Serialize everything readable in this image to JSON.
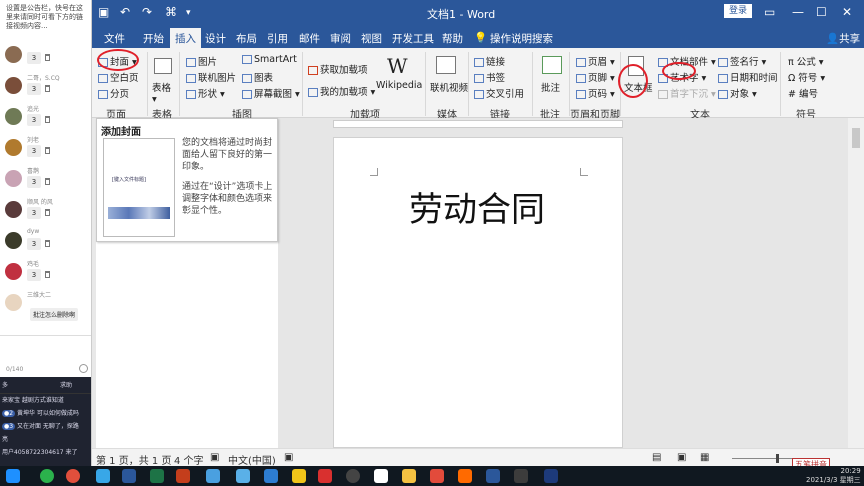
{
  "chat": {
    "note": "设置是公告栏，快号在这里来请同时可看下方的链接视频内容...",
    "messages": [
      {
        "name": "",
        "count": "3",
        "color": "#8a6b52"
      },
      {
        "name": "二哥，S.CQ",
        "count": "3",
        "color": "#7a4e3a"
      },
      {
        "name": "追光",
        "count": "3",
        "color": "#6f7a56"
      },
      {
        "name": "刘老",
        "count": "3",
        "color": "#b07a2e"
      },
      {
        "name": "喜鹊",
        "count": "3",
        "color": "#c9a3b4"
      },
      {
        "name": "顺风 的风",
        "count": "3",
        "color": "#5a3b3b"
      },
      {
        "name": "dyw",
        "count": "3",
        "color": "#3b3b2a"
      },
      {
        "name": "鸡毛",
        "count": "3",
        "color": "#c03040"
      },
      {
        "name": "三维大二",
        "count": "",
        "color": "#e8d5c0"
      }
    ],
    "reply": "批注怎么删除啊",
    "counter": "0/140",
    "dark_header": "多",
    "dark_request": "求助",
    "dark_lines": [
      "来家宝 越剧方式谁知道",
      "黄坤华 可以如何做成吗",
      "又在对面 无聊了，探路",
      "亮",
      "用户4058722304617 来了"
    ]
  },
  "word": {
    "title": "文档1 - Word",
    "login": "登录",
    "tabs": [
      "文件",
      "开始",
      "插入",
      "设计",
      "布局",
      "引用",
      "邮件",
      "审阅",
      "视图",
      "开发工具",
      "帮助"
    ],
    "active_tab": "插入",
    "tell_me": "操作说明搜索",
    "share": "共享",
    "ribbon": {
      "cover": "封面",
      "blank": "空白页",
      "page_break": "分页",
      "table": "表格",
      "picture": "图片",
      "online_picture": "联机图片",
      "shapes": "形状",
      "smartart": "SmartArt",
      "chart": "图表",
      "screenshot": "屏幕截图",
      "get_addins": "获取加载项",
      "my_addins": "我的加载项",
      "wikipedia": "Wikipedia",
      "online_video": "联机视频",
      "link": "链接",
      "bookmark": "书签",
      "cross_ref": "交叉引用",
      "comment": "批注",
      "header": "页眉",
      "footer": "页脚",
      "page_number": "页码",
      "textbox": "文本框",
      "quick_parts": "文档部件",
      "wordart": "艺术字",
      "drop_cap": "首字下沉",
      "signature": "签名行",
      "datetime": "日期和时间",
      "object": "对象",
      "equation": "公式",
      "symbol": "符号",
      "numbering": "编号",
      "groups": [
        "页面",
        "表格",
        "插图",
        "加载项",
        "媒体",
        "链接",
        "批注",
        "页眉和页脚",
        "文本",
        "符号"
      ]
    },
    "tooltip": {
      "title": "添加封面",
      "desc1": "您的文档将通过时尚封面给人留下良好的第一印象。",
      "desc2": "通过在“设计”选项卡上调整字体和颜色选项来彰显个性。",
      "thumb_title": "[键入文件标题]"
    },
    "document": {
      "title_text": "劳动合同"
    },
    "status": {
      "page": "第 1 页，共 1 页",
      "words": "4 个字",
      "lang": "中文(中国)",
      "ime": "五笔拼音"
    }
  },
  "taskbar": {
    "time": "20:29",
    "date": "2021/3/3 星期三"
  }
}
